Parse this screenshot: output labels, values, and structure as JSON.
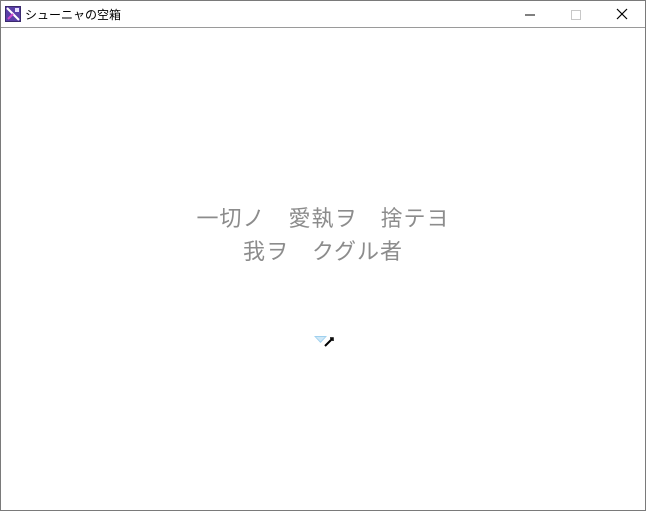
{
  "window": {
    "title": "シューニャの空箱",
    "icon": "game-app-icon",
    "controls": [
      "minimize-icon",
      "maximize-icon",
      "close-icon"
    ]
  },
  "message": {
    "line1": "一切ノ　愛執ヲ　捨テヨ",
    "line2": "我ヲ　クグル者",
    "color": "#8c8c8c"
  },
  "cursor": {
    "icon": "wait-cursor-icon"
  }
}
